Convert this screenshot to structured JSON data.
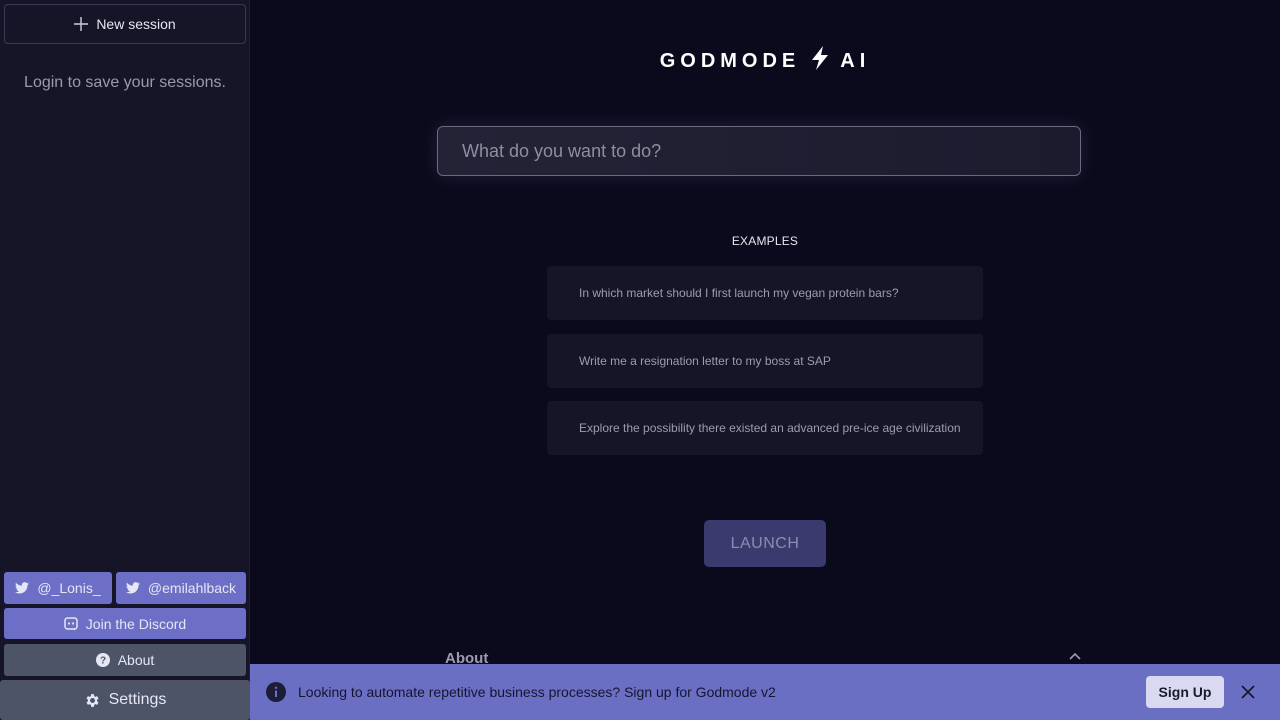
{
  "sidebar": {
    "new_session_label": "New session",
    "login_hint": "Login to save your sessions.",
    "twitter_1": "@_Lonis_",
    "twitter_2": "@emilahlback",
    "discord_label": "Join the Discord",
    "about_label": "About",
    "settings_label": "Settings"
  },
  "main": {
    "logo_left": "GODMODE",
    "logo_right": "AI",
    "search_placeholder": "What do you want to do?",
    "examples_title": "EXAMPLES",
    "examples": [
      "In which market should I first launch my vegan protein bars?",
      "Write me a resignation letter to my boss at SAP",
      "Explore the possibility there existed an advanced pre-ice age civilization"
    ],
    "launch_label": "LAUNCH",
    "about_section_label": "About"
  },
  "banner": {
    "text": "Looking to automate repetitive business processes? Sign up for Godmode v2",
    "signup_label": "Sign Up"
  },
  "colors": {
    "background": "#0b0a1c",
    "sidebar": "#161528",
    "accent": "#6d6fc6",
    "secondary_button": "#4d5468",
    "launch_button": "#3b3a6e"
  },
  "icons": {
    "new_session": "plus-icon",
    "twitter": "twitter-icon",
    "discord": "discord-icon",
    "about": "question-icon",
    "settings": "gear-icon",
    "logo": "lightning-bolt-icon",
    "about_toggle": "chevron-up-icon",
    "banner_info": "info-icon",
    "banner_close": "close-icon"
  }
}
